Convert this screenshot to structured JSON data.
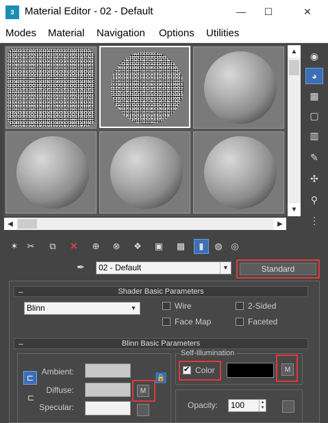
{
  "window": {
    "title": "Material Editor - 02 - Default",
    "app_icon_text": "3",
    "minimize": "—",
    "maximize": "☐",
    "close": "✕"
  },
  "menu": [
    "Modes",
    "Material",
    "Navigation",
    "Options",
    "Utilities"
  ],
  "slot_scroll": {
    "up": "▲",
    "down": "▼",
    "left": "◀",
    "right": "▶"
  },
  "side_toolbar": [
    "◉",
    "◕",
    "▦",
    "▢",
    "▥",
    "✎",
    "✣",
    "⚲",
    "⋮"
  ],
  "bottom_toolbar": [
    "✶",
    "✂",
    "⧉",
    "✕",
    "⊕",
    "⊗",
    "❖",
    "▣",
    "▩",
    "▮",
    "◍",
    "◎"
  ],
  "material": {
    "picker_icon": "✒",
    "name": "02 - Default",
    "caret": "▼",
    "type_button": "Standard"
  },
  "shader_rollout": {
    "minus": "–",
    "title": "Shader Basic Parameters",
    "shader": "Blinn",
    "caret": "▼",
    "wire": "Wire",
    "two_sided": "2-Sided",
    "face_map": "Face Map",
    "faceted": "Faceted"
  },
  "blinn_rollout": {
    "minus": "–",
    "title": "Blinn Basic Parameters",
    "ambient": "Ambient:",
    "diffuse": "Diffuse:",
    "specular": "Specular:",
    "diffuse_map_button": "M",
    "lock_icon": "⊏",
    "lock_icon2": "⊏",
    "small_lock_icon": "🔒",
    "self_illumination": {
      "caption": "Self-Illumination",
      "color_label": "Color",
      "map_button": "M"
    },
    "opacity": {
      "label": "Opacity:",
      "value": "100",
      "arrows": "▲ ▼"
    }
  },
  "colors": {
    "ambient": "#c8c8c8",
    "diffuse": "#c8c8c8",
    "specular": "#f2f2f2",
    "self_illum": "#000000",
    "highlight_box": "#e03a3a",
    "active_button": "#3d6fb5"
  }
}
